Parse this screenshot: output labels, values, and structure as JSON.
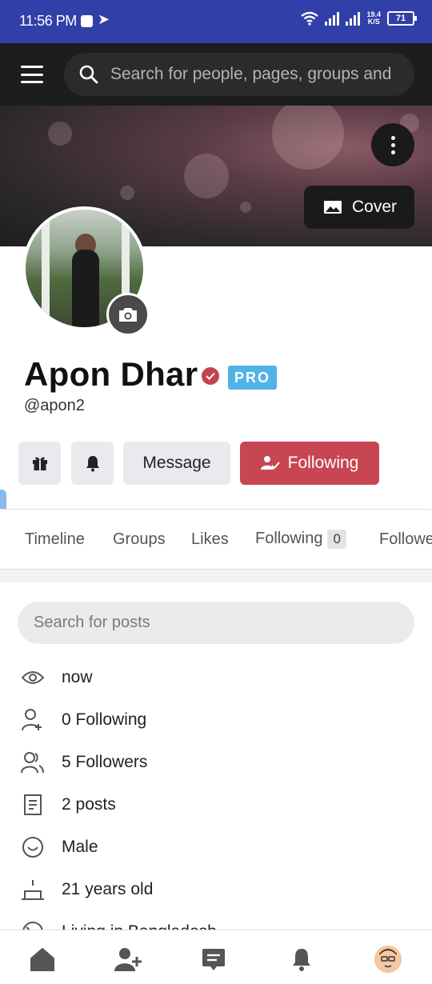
{
  "status_bar": {
    "time": "11:56 PM",
    "speed_value": "19.4",
    "speed_unit": "K/S",
    "battery": "71"
  },
  "header": {
    "search_placeholder": "Search for people, pages, groups and"
  },
  "cover": {
    "cover_button_label": "Cover"
  },
  "profile": {
    "name": "Apon Dhar",
    "badge": "PRO",
    "handle": "@apon2"
  },
  "actions": {
    "message_label": "Message",
    "following_label": "Following"
  },
  "tabs": [
    {
      "label": "Timeline"
    },
    {
      "label": "Groups"
    },
    {
      "label": "Likes"
    },
    {
      "label": "Following",
      "count": "0"
    },
    {
      "label": "Followers"
    }
  ],
  "posts": {
    "search_placeholder": "Search for posts"
  },
  "info": [
    {
      "icon": "eye-icon",
      "text": "now"
    },
    {
      "icon": "user-add-icon",
      "text": "0 Following"
    },
    {
      "icon": "users-icon",
      "text": "5 Followers"
    },
    {
      "icon": "document-icon",
      "text": "2 posts"
    },
    {
      "icon": "smile-icon",
      "text": "Male"
    },
    {
      "icon": "cake-icon",
      "text": "21 years old"
    },
    {
      "icon": "globe-icon",
      "text": "Living in Bangladesh"
    }
  ],
  "colors": {
    "status_bar": "#3140a8",
    "header": "#1c1d1d",
    "accent_follow": "#c84552",
    "pro_badge": "#4fb3e8"
  }
}
